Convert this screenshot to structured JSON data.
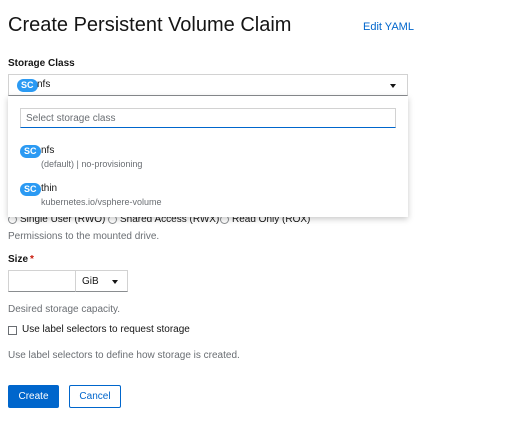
{
  "page": {
    "title": "Create Persistent Volume Claim",
    "edit_yaml": "Edit YAML"
  },
  "storage_class": {
    "label": "Storage Class",
    "selected_badge": "SC",
    "selected_value": "nfs",
    "search_placeholder": "Select storage class",
    "options": [
      {
        "badge": "SC",
        "name": "nfs",
        "description": "(default) | no-provisioning"
      },
      {
        "badge": "SC",
        "name": "thin",
        "description": "kubernetes.io/vsphere-volume"
      }
    ]
  },
  "access_mode": {
    "options": [
      {
        "label": "Single User (RWO)"
      },
      {
        "label": "Shared Access (RWX)"
      },
      {
        "label": "Read Only (ROX)"
      }
    ],
    "help": "Permissions to the mounted drive."
  },
  "size": {
    "label": "Size",
    "required_marker": "*",
    "value": "",
    "unit": "GiB",
    "help": "Desired storage capacity."
  },
  "label_selector": {
    "checkbox_label": "Use label selectors to request storage",
    "checked": false,
    "help": "Use label selectors to define how storage is created."
  },
  "actions": {
    "create": "Create",
    "cancel": "Cancel"
  },
  "colors": {
    "primary": "#0066cc",
    "badge": "#2b9af3",
    "required": "#c9190b"
  }
}
